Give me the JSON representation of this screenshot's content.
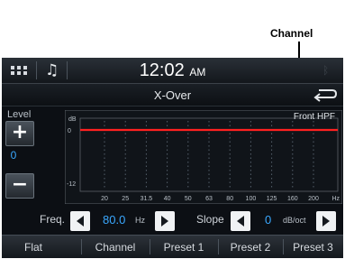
{
  "callout": {
    "label": "Channel"
  },
  "statusbar": {
    "time": "12:02",
    "ampm": "AM"
  },
  "header": {
    "title": "X-Over"
  },
  "level": {
    "label": "Level",
    "value": "0"
  },
  "graph": {
    "y_unit": "dB",
    "y_top_label": "0",
    "y_bottom_label": "-12",
    "channel_label": "Front HPF",
    "x_ticks": [
      "20",
      "25",
      "31.5",
      "40",
      "50",
      "63",
      "80",
      "100",
      "125",
      "160",
      "200"
    ],
    "x_unit": "Hz"
  },
  "freq": {
    "label": "Freq.",
    "value": "80.0",
    "unit": "Hz"
  },
  "slope": {
    "label": "Slope",
    "value": "0",
    "unit": "dB/oct"
  },
  "bottom_tabs": [
    "Flat",
    "Channel",
    "Preset 1",
    "Preset 2",
    "Preset 3"
  ],
  "colors": {
    "response_line": "#ff2020",
    "accent_value": "#3aa8ff"
  }
}
